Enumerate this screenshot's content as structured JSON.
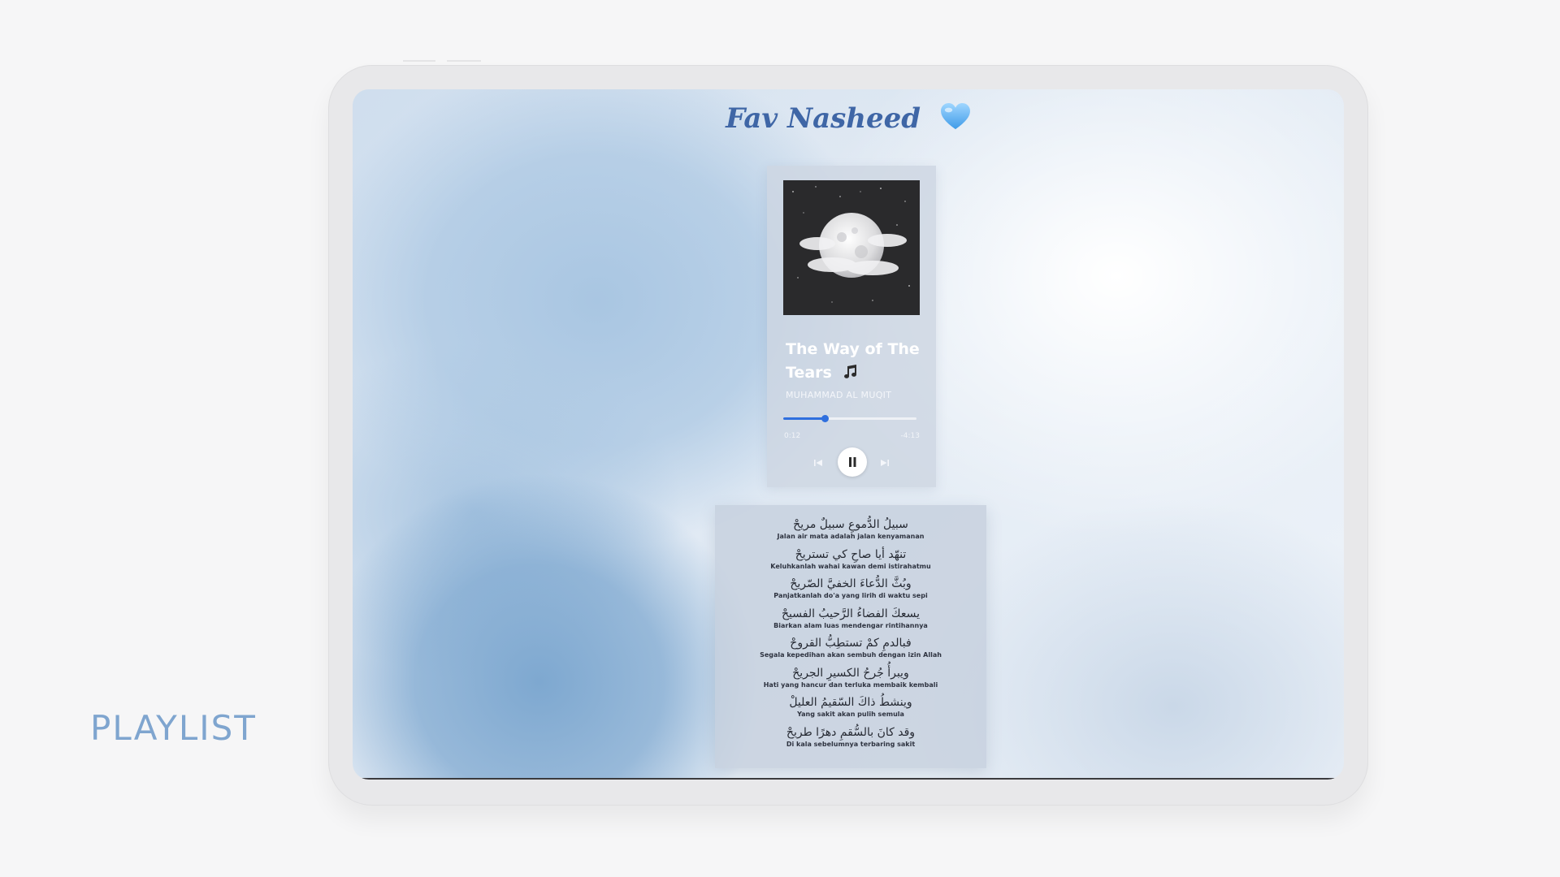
{
  "side_label": "PLAYLIST",
  "app": {
    "title": "Fav Nasheed",
    "icons": {
      "heart": "heart-icon",
      "note": "music-note-icon"
    },
    "colors": {
      "accent": "#2f6fde",
      "title": "#3f66a6",
      "side_label": "#7fa5cf"
    }
  },
  "player": {
    "track_title": "The Way of The Tears",
    "artist": "MUHAMMAD AL MUQIT",
    "elapsed": "0:12",
    "remaining": "-4:13",
    "progress": 0.31,
    "state": "playing",
    "controls": {
      "prev": "skip-back-icon",
      "pause": "pause-icon",
      "next": "skip-forward-icon"
    }
  },
  "lyrics": [
    {
      "arabic": "سبيلُ الدُّموعِ سبيلٌ مريحْ",
      "translation": "Jalan air mata adalah jalan kenyamanan"
    },
    {
      "arabic": "تنهّد أيا صاحِ كي تستريحْ",
      "translation": "Keluhkanlah wahai kawan demi istirahatmu"
    },
    {
      "arabic": "وبُثَّ الدُّعاءَ الخفيَّ الصّريحْ",
      "translation": "Panjatkanlah do'a yang lirih di waktu sepi"
    },
    {
      "arabic": "يسعكَ الفضاءُ الرَّحيبُ الفسيحْ",
      "translation": "Biarkan alam luas mendengar rintihannya"
    },
    {
      "arabic": "فبالدمِ كمْ تستطِبُّ القروحْ",
      "translation": "Segala kepedihan akan sembuh dengan izin Allah"
    },
    {
      "arabic": "ويبرأُ جُرحُ الكسيرِ الجريحْ",
      "translation": "Hati yang hancur dan terluka membaik kembali"
    },
    {
      "arabic": "وينشطُ ذاكَ السّقيمُ العليلْ",
      "translation": "Yang sakit akan pulih semula"
    },
    {
      "arabic": "وقد كانَ بالسُّقمِ دهرًا طريحْ",
      "translation": "Di kala sebelumnya terbaring sakit"
    }
  ]
}
